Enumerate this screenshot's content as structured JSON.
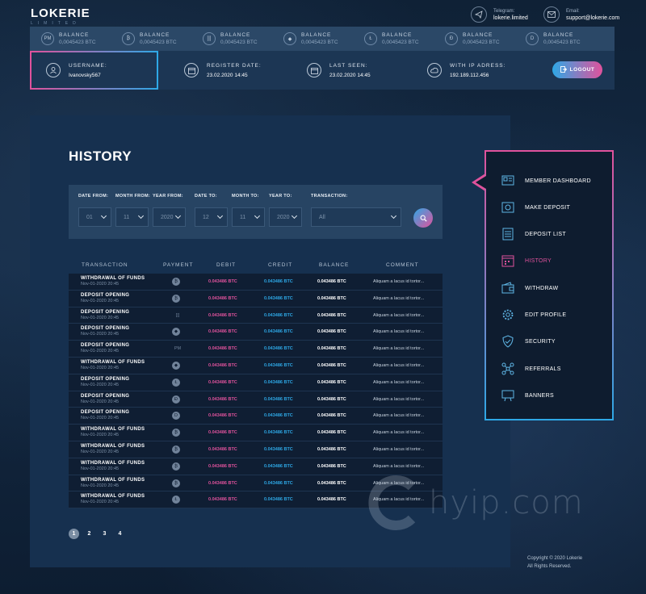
{
  "header": {
    "brand": "LOKERIE",
    "brand_sub": "LIMITED",
    "telegram_label": "Telegram:",
    "telegram_value": "lokerie.limited",
    "email_label": "Email:",
    "email_value": "support@lokerie.com"
  },
  "balances": [
    {
      "icon": "perfect-money-icon",
      "glyph": "PM",
      "label": "BALANCE",
      "value": "0,0045423 BTC"
    },
    {
      "icon": "bitcoin-icon",
      "glyph": "₿",
      "label": "BALANCE",
      "value": "0,0045423 BTC"
    },
    {
      "icon": "payeer-icon",
      "glyph": "[|]",
      "label": "BALANCE",
      "value": "0,0045423 BTC"
    },
    {
      "icon": "ethereum-icon",
      "glyph": "◆",
      "label": "BALANCE",
      "value": "0,0045423 BTC"
    },
    {
      "icon": "litecoin-icon",
      "glyph": "Ł",
      "label": "BALANCE",
      "value": "0,0045423 BTC"
    },
    {
      "icon": "dogecoin-icon",
      "glyph": "Ð",
      "label": "BALANCE",
      "value": "0,0045423 BTC"
    },
    {
      "icon": "dash-icon",
      "glyph": "D",
      "label": "BALANCE",
      "value": "0,0045423 BTC"
    }
  ],
  "user": {
    "username_label": "USERNAME:",
    "username": "Ivanovsky567",
    "register_label": "REGISTER DATE:",
    "register_value": "23.02.2020  14:45",
    "last_seen_label": "LAST SEEN:",
    "last_seen_value": "23.02.2020  14:45",
    "ip_label": "WITH IP ADRESS:",
    "ip_value": "192.189.112.456",
    "logout_label": "LOGOUT"
  },
  "history": {
    "title": "HISTORY",
    "filters": {
      "date_from_label": "DATE FROM:",
      "date_from": "01",
      "month_from_label": "MONTH FROM:",
      "month_from": "11",
      "year_from_label": "YEAR FROM:",
      "year_from": "2020",
      "date_to_label": "DATE TO:",
      "date_to": "12",
      "month_to_label": "MONTH TO:",
      "month_to": "11",
      "year_to_label": "YEAR TO:",
      "year_to": "2020",
      "transaction_label": "TRANSACTION:",
      "transaction": "All"
    },
    "columns": [
      "TRANSACTION",
      "PAYMENT",
      "DEBIT",
      "CREDIT",
      "BALANCE",
      "COMMENT"
    ],
    "rows": [
      {
        "type": "WITHDRAWAL OF FUNDS",
        "date": "Nov-01-2020  20:45",
        "payment": "bitcoin-icon",
        "glyph": "₿",
        "debit": "0.043486 BTC",
        "credit": "0.043486 BTC",
        "balance": "0.043486 BTC",
        "comment": "Aliquam a lacus id tortor..."
      },
      {
        "type": "DEPOSIT OPENING",
        "date": "Nov-01-2020  20:45",
        "payment": "bitcoin-icon",
        "glyph": "₿",
        "debit": "0.043486 BTC",
        "credit": "0.043486 BTC",
        "balance": "0.043486 BTC",
        "comment": "Aliquam a lacus id tortor..."
      },
      {
        "type": "DEPOSIT OPENING",
        "date": "Nov-01-2020  20:45",
        "payment": "payeer-icon",
        "glyph": "[|]",
        "debit": "0.043486 BTC",
        "credit": "0.043486 BTC",
        "balance": "0.043486 BTC",
        "comment": "Aliquam a lacus id tortor..."
      },
      {
        "type": "DEPOSIT OPENING",
        "date": "Nov-01-2020  20:45",
        "payment": "ethereum-icon",
        "glyph": "◆",
        "debit": "0.043486 BTC",
        "credit": "0.043486 BTC",
        "balance": "0.043486 BTC",
        "comment": "Aliquam a lacus id tortor..."
      },
      {
        "type": "DEPOSIT OPENING",
        "date": "Nov-01-2020  20:45",
        "payment": "perfect-money-icon",
        "glyph": "PM",
        "debit": "0.043486 BTC",
        "credit": "0.043486 BTC",
        "balance": "0.043486 BTC",
        "comment": "Aliquam a lacus id tortor..."
      },
      {
        "type": "WITHDRAWAL OF FUNDS",
        "date": "Nov-01-2020  20:45",
        "payment": "ethereum-icon",
        "glyph": "◆",
        "debit": "0.043486 BTC",
        "credit": "0.043486 BTC",
        "balance": "0.043486 BTC",
        "comment": "Aliquam a lacus id tortor..."
      },
      {
        "type": "DEPOSIT OPENING",
        "date": "Nov-01-2020  20:45",
        "payment": "litecoin-icon",
        "glyph": "Ł",
        "debit": "0.043486 BTC",
        "credit": "0.043486 BTC",
        "balance": "0.043486 BTC",
        "comment": "Aliquam a lacus id tortor..."
      },
      {
        "type": "DEPOSIT OPENING",
        "date": "Nov-01-2020  20:45",
        "payment": "dogecoin-icon",
        "glyph": "Ð",
        "debit": "0.043486 BTC",
        "credit": "0.043486 BTC",
        "balance": "0.043486 BTC",
        "comment": "Aliquam a lacus id tortor..."
      },
      {
        "type": "DEPOSIT OPENING",
        "date": "Nov-01-2020  20:45",
        "payment": "dash-icon",
        "glyph": "D",
        "debit": "0.043486 BTC",
        "credit": "0.043486 BTC",
        "balance": "0.043486 BTC",
        "comment": "Aliquam a lacus id tortor..."
      },
      {
        "type": "WITHDRAWAL OF FUNDS",
        "date": "Nov-01-2020  20:45",
        "payment": "bitcoin-icon",
        "glyph": "₿",
        "debit": "0.043486 BTC",
        "credit": "0.043486 BTC",
        "balance": "0.043486 BTC",
        "comment": "Aliquam a lacus id tortor..."
      },
      {
        "type": "WITHDRAWAL OF FUNDS",
        "date": "Nov-01-2020  20:45",
        "payment": "bitcoin-icon",
        "glyph": "₿",
        "debit": "0.043486 BTC",
        "credit": "0.043486 BTC",
        "balance": "0.043486 BTC",
        "comment": "Aliquam a lacus id tortor..."
      },
      {
        "type": "WITHDRAWAL OF FUNDS",
        "date": "Nov-01-2020  20:45",
        "payment": "bitcoin-icon",
        "glyph": "₿",
        "debit": "0.043486 BTC",
        "credit": "0.043486 BTC",
        "balance": "0.043486 BTC",
        "comment": "Aliquam a lacus id tortor..."
      },
      {
        "type": "WITHDRAWAL OF FUNDS",
        "date": "Nov-01-2020  20:45",
        "payment": "bitcoin-icon",
        "glyph": "₿",
        "debit": "0.043486 BTC",
        "credit": "0.043486 BTC",
        "balance": "0.043486 BTC",
        "comment": "Aliquam a lacus id tortor..."
      },
      {
        "type": "WITHDRAWAL OF FUNDS",
        "date": "Nov-01-2020  20:45",
        "payment": "litecoin-icon",
        "glyph": "Ł",
        "debit": "0.043486 BTC",
        "credit": "0.043486 BTC",
        "balance": "0.043486 BTC",
        "comment": "Aliquam a lacus id tortor..."
      }
    ],
    "pages": [
      "1",
      "2",
      "3",
      "4"
    ],
    "active_page": "1"
  },
  "menu": {
    "items": [
      {
        "label": "MEMBER DASHBOARD",
        "icon": "dashboard-icon",
        "active": false
      },
      {
        "label": "MAKE DEPOSIT",
        "icon": "safe-icon",
        "active": false
      },
      {
        "label": "DEPOSIT LIST",
        "icon": "list-icon",
        "active": false
      },
      {
        "label": "HISTORY",
        "icon": "calendar-icon",
        "active": true
      },
      {
        "label": "WITHDRAW",
        "icon": "wallet-icon",
        "active": false
      },
      {
        "label": "EDIT PROFILE",
        "icon": "gear-icon",
        "active": false
      },
      {
        "label": "SECURITY",
        "icon": "shield-icon",
        "active": false
      },
      {
        "label": "REFERRALS",
        "icon": "network-icon",
        "active": false
      },
      {
        "label": "BANNERS",
        "icon": "banner-icon",
        "active": false
      }
    ]
  },
  "footer": {
    "copyright": "Copyright © 2020 Lokerie",
    "rights": "All Rights Reserved."
  },
  "watermark": {
    "text": "hyip.com"
  },
  "colors": {
    "pink": "#e0529c",
    "blue": "#2ea8e6",
    "panel": "#16304f",
    "background": "#0f2136"
  }
}
